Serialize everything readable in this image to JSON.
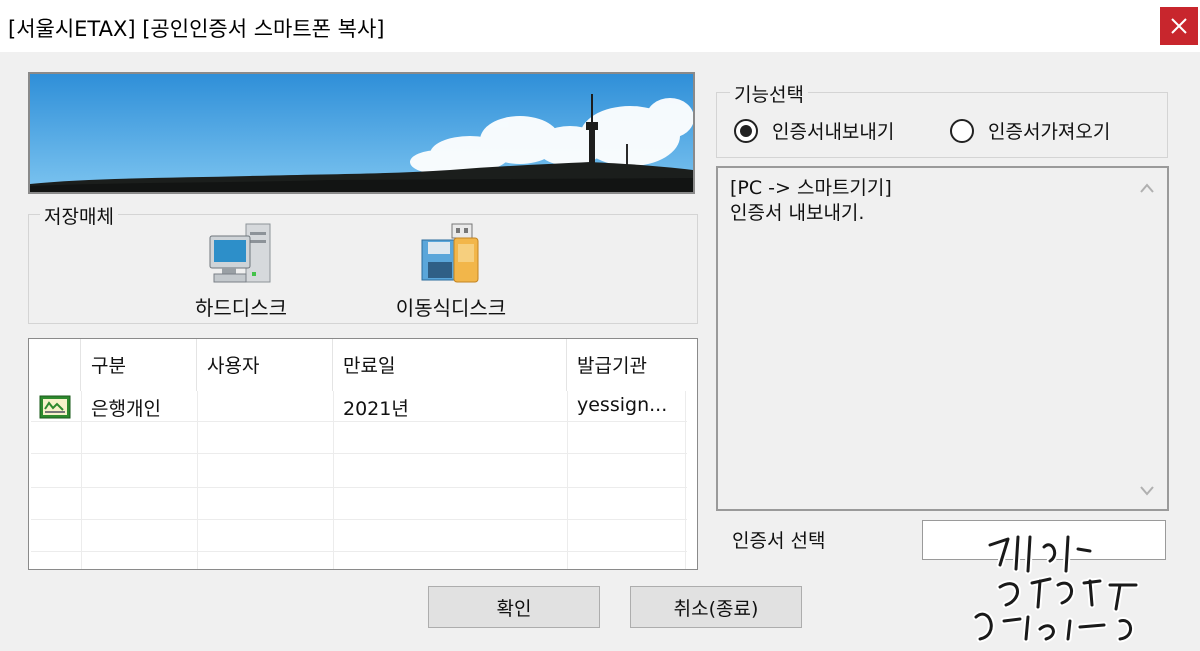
{
  "window": {
    "title": "[서울시ETAX] [공인인증서 스마트폰 복사]"
  },
  "storage": {
    "group_label": "저장매체",
    "items": [
      {
        "label": "하드디스크",
        "icon": "computer-icon"
      },
      {
        "label": "이동식디스크",
        "icon": "removable-disk-icon"
      }
    ]
  },
  "table": {
    "headers": [
      "구분",
      "사용자",
      "만료일",
      "발급기관"
    ],
    "rows": [
      {
        "icon": "certificate-icon",
        "type": "은행개인",
        "user": "",
        "expiry": "2021년",
        "issuer": "yessign..."
      }
    ]
  },
  "function": {
    "group_label": "기능선택",
    "options": [
      {
        "label": "인증서내보내기",
        "selected": true
      },
      {
        "label": "인증서가져오기",
        "selected": false
      }
    ]
  },
  "info": {
    "line1": "[PC -> 스마트기기]",
    "line2": "인증서 내보내기."
  },
  "cert_select": {
    "label": "인증서 선택",
    "value": ""
  },
  "buttons": {
    "ok": "확인",
    "cancel": "취소(종료)"
  },
  "colors": {
    "close": "#c8262d",
    "sky": "#3f9ee0",
    "background": "#f0f0f0"
  }
}
